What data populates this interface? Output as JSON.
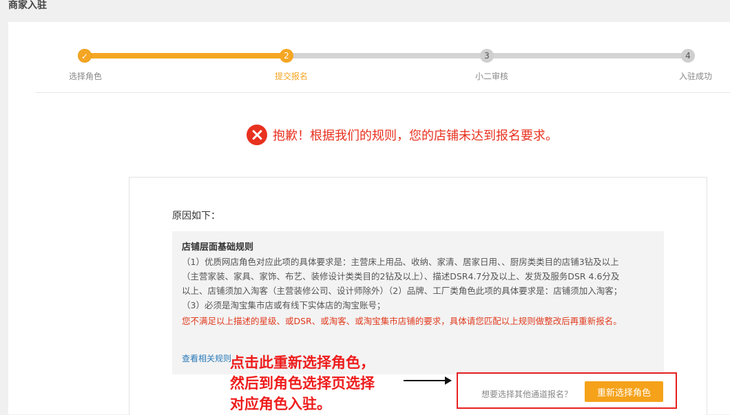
{
  "header": {
    "title": "商家入驻"
  },
  "stepper": {
    "steps": [
      {
        "number": "✓",
        "label": "选择角色"
      },
      {
        "number": "2",
        "label": "提交报名"
      },
      {
        "number": "3",
        "label": "小二审核"
      },
      {
        "number": "4",
        "label": "入驻成功"
      }
    ]
  },
  "error": {
    "message": "抱歉！根据我们的规则，您的店铺未达到报名要求。"
  },
  "reasons": {
    "title": "原因如下：",
    "rule_heading": "店铺层面基础规则",
    "rule_body": "（1）优质网店角色对应此项的具体要求是：主营床上用品、收纳、家清、居家日用、、厨房类类目的店铺3钻及以上（主营家装、家具、家饰、布艺、装修设计类类目的2钻及以上）、描述DSR4.7分及以上、发货及服务DSR 4.6分及以上、店铺须加入淘客（主营装修公司、设计师除外）（2）品牌、工厂类角色此项的具体要求是：店铺须加入淘客；（3）必须是淘宝集市店或有线下实体店的淘宝账号；",
    "rule_warning": "您不满足以上描述的星级、或DSR、或淘客、或淘宝集市店铺的要求，具体请您匹配以上规则做整改后再重新报名。",
    "rule_link": "查看相关规则"
  },
  "annotation": {
    "lines": [
      "点击此重新选择角色，",
      "然后到角色选择页选择",
      "对应角色入驻。"
    ]
  },
  "actions": {
    "alt_question": "想要选择其他通道报名？",
    "reselect_label": "重新选择角色"
  },
  "colors": {
    "accent": "#f5a623",
    "error": "#e8311f",
    "link": "#2a7ab8"
  }
}
